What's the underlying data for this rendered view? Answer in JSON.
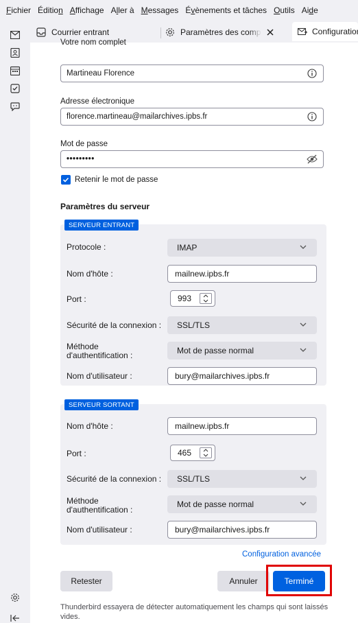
{
  "menubar": [
    {
      "pre": "",
      "u": "F",
      "post": "ichier"
    },
    {
      "pre": "Éditio",
      "u": "n",
      "post": ""
    },
    {
      "pre": "",
      "u": "A",
      "post": "ffichage"
    },
    {
      "pre": "A",
      "u": "l",
      "post": "ler à"
    },
    {
      "pre": "",
      "u": "M",
      "post": "essages"
    },
    {
      "pre": "É",
      "u": "v",
      "post": "ènements et tâches"
    },
    {
      "pre": "",
      "u": "O",
      "post": "utils"
    },
    {
      "pre": "Ai",
      "u": "d",
      "post": "e"
    }
  ],
  "tabs": {
    "inbox": "Courrier entrant",
    "accounts": "Paramètres des comptes Co",
    "config": "Configuration"
  },
  "form": {
    "name_label": "Votre nom complet",
    "name_value": "Martineau Florence",
    "email_label": "Adresse électronique",
    "email_value": "florence.martineau@mailarchives.ipbs.fr",
    "password_label": "Mot de passe",
    "password_value": "•••••••••",
    "remember_label": "Retenir le mot de passe",
    "remember_checked": true
  },
  "server_settings_title": "Paramètres du serveur",
  "incoming": {
    "badge": "SERVEUR ENTRANT",
    "protocol_label": "Protocole :",
    "protocol_value": "IMAP",
    "host_label": "Nom d'hôte :",
    "host_value": "mailnew.ipbs.fr",
    "port_label": "Port :",
    "port_value": "993",
    "security_label": "Sécurité de la connexion :",
    "security_value": "SSL/TLS",
    "auth_label_1": "Méthode",
    "auth_label_2": "d'authentification :",
    "auth_value": "Mot de passe normal",
    "user_label": "Nom d'utilisateur :",
    "user_value": "bury@mailarchives.ipbs.fr"
  },
  "outgoing": {
    "badge": "SERVEUR SORTANT",
    "host_label": "Nom d'hôte :",
    "host_value": "mailnew.ipbs.fr",
    "port_label": "Port :",
    "port_value": "465",
    "security_label": "Sécurité de la connexion :",
    "security_value": "SSL/TLS",
    "auth_label_1": "Méthode",
    "auth_label_2": "d'authentification :",
    "auth_value": "Mot de passe normal",
    "user_label": "Nom d'utilisateur :",
    "user_value": "bury@mailarchives.ipbs.fr"
  },
  "advanced_link": "Configuration avancée",
  "buttons": {
    "retest": "Retester",
    "cancel": "Annuler",
    "done": "Terminé"
  },
  "footnote_line1": "Thunderbird essayera de détecter automatiquement les champs qui sont laissés",
  "footnote_line2": "vides.",
  "colors": {
    "accent": "#0060df",
    "highlight": "#e00000"
  }
}
